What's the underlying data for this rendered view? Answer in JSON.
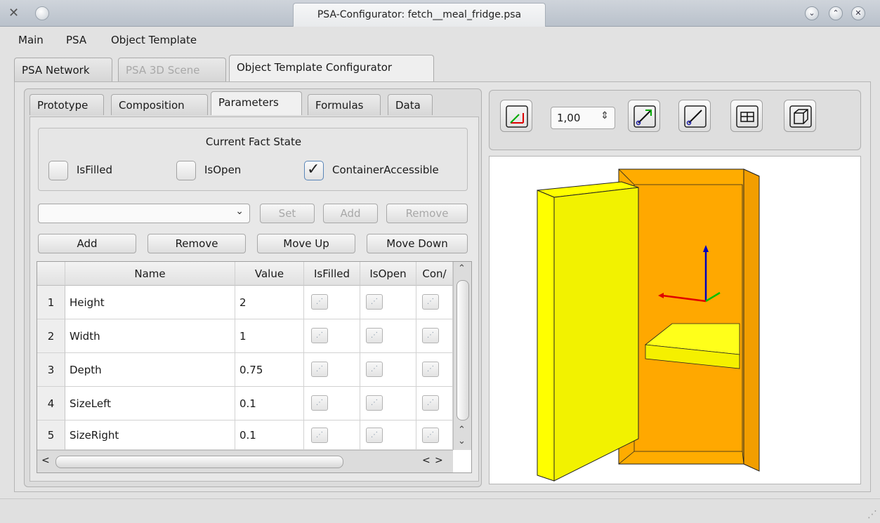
{
  "window": {
    "title": "PSA-Configurator: fetch__meal_fridge.psa",
    "buttons": [
      "chevron-down-icon",
      "chevron-up-icon",
      "close-icon"
    ]
  },
  "menubar": [
    "Main",
    "PSA",
    "Object Template"
  ],
  "top_tabs": [
    {
      "label": "PSA Network",
      "state": "normal"
    },
    {
      "label": "PSA 3D Scene",
      "state": "disabled"
    },
    {
      "label": "Object Template Configurator",
      "state": "active"
    }
  ],
  "sub_tabs": [
    {
      "label": "Prototype"
    },
    {
      "label": "Composition"
    },
    {
      "label": "Parameters",
      "active": true
    },
    {
      "label": "Formulas"
    },
    {
      "label": "Data"
    }
  ],
  "fact_state": {
    "title": "Current Fact State",
    "checkboxes": [
      {
        "label": "IsFilled",
        "checked": false
      },
      {
        "label": "IsOpen",
        "checked": false
      },
      {
        "label": "ContainerAccessible",
        "checked": true
      }
    ]
  },
  "fact_controls": {
    "combo_value": "",
    "set": "Set",
    "add": "Add",
    "remove": "Remove"
  },
  "param_buttons": {
    "add": "Add",
    "remove": "Remove",
    "move_up": "Move Up",
    "move_down": "Move Down"
  },
  "table": {
    "headers": [
      "Name",
      "Value",
      "IsFilled",
      "IsOpen",
      "Con/"
    ],
    "rows": [
      {
        "n": "1",
        "name": "Height",
        "value": "2"
      },
      {
        "n": "2",
        "name": "Width",
        "value": "1"
      },
      {
        "n": "3",
        "name": "Depth",
        "value": "0.75"
      },
      {
        "n": "4",
        "name": "SizeLeft",
        "value": "0.1"
      },
      {
        "n": "5",
        "name": "SizeRight",
        "value": "0.1"
      }
    ]
  },
  "viewer": {
    "zoom": "1,00",
    "colors": {
      "body": "#ffa500",
      "door": "#ffff00",
      "shelf": "#ffff22",
      "axis_x": "#e00000",
      "axis_y": "#00c000",
      "axis_z": "#0000c0"
    }
  }
}
